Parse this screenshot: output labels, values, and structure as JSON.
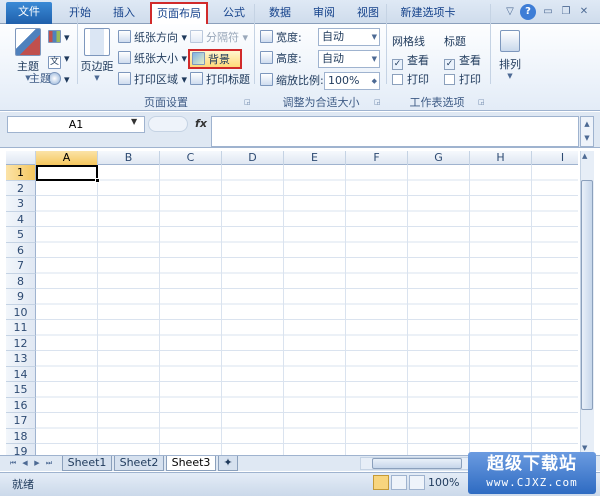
{
  "tabs": [
    "文件",
    "开始",
    "插入",
    "页面布局",
    "公式",
    "数据",
    "审阅",
    "视图",
    "新建选项卡"
  ],
  "active_tab": "页面布局",
  "ribbon": {
    "themes": {
      "label": "主题",
      "group": "主题"
    },
    "page_setup": {
      "group": "页面设置",
      "margins": "页边距",
      "orientation": "纸张方向",
      "size": "纸张大小",
      "print_area": "打印区域",
      "breaks": "分隔符",
      "background": "背景",
      "print_titles": "打印标题"
    },
    "scale_to_fit": {
      "group": "调整为合适大小",
      "width_label": "宽度:",
      "width_value": "自动",
      "height_label": "高度:",
      "height_value": "自动",
      "scale_label": "缩放比例:",
      "scale_value": "100%"
    },
    "sheet_options": {
      "group": "工作表选项",
      "gridlines": "网格线",
      "headings": "标题",
      "view": "查看",
      "print": "打印",
      "gridlines_view": true,
      "headings_view": true
    },
    "arrange": {
      "label": "排列"
    }
  },
  "formula_bar": {
    "name_box": "A1",
    "fx": "fx",
    "value": ""
  },
  "columns": [
    "A",
    "B",
    "C",
    "D",
    "E",
    "F",
    "G",
    "H",
    "I"
  ],
  "rows": [
    "1",
    "2",
    "3",
    "4",
    "5",
    "6",
    "7",
    "8",
    "9",
    "10",
    "11",
    "12",
    "13",
    "14",
    "15",
    "16",
    "17",
    "18",
    "19"
  ],
  "selected_cell": {
    "col": "A",
    "row": "1"
  },
  "sheets": [
    "Sheet1",
    "Sheet2",
    "Sheet3"
  ],
  "active_sheet": "Sheet3",
  "status": {
    "text": "就绪",
    "zoom": "100%"
  },
  "watermark": {
    "line1": "超级下载站",
    "line2": "www.CJXZ.com"
  },
  "colors": {
    "file_tab": "#2a72c4",
    "highlight_border": "#d12a2a",
    "selection": "#f5c75e"
  }
}
